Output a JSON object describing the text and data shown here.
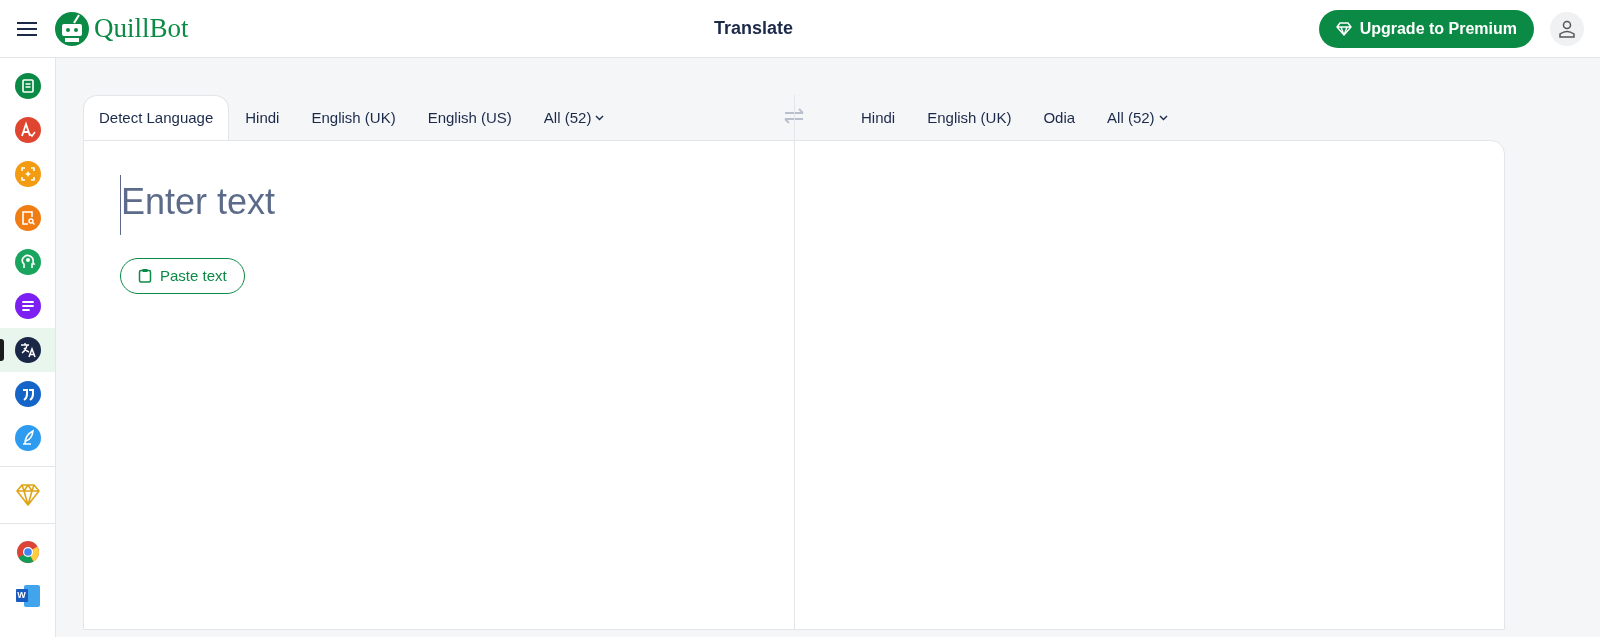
{
  "header": {
    "logo_text": "QuillBot",
    "title": "Translate",
    "upgrade_button": "Upgrade to Premium"
  },
  "sidebar": {
    "groups": [
      {
        "items": [
          {
            "kind": "paraphraser",
            "color": "#0b8a45",
            "selected": false
          },
          {
            "kind": "grammar",
            "color": "#e0452f",
            "selected": false
          },
          {
            "kind": "detector",
            "color": "#f39c12",
            "selected": false
          },
          {
            "kind": "plagiarism",
            "color": "#f07c14",
            "selected": false
          },
          {
            "kind": "humanizer",
            "color": "#1aa55e",
            "selected": false
          },
          {
            "kind": "summarizer",
            "color": "#7b1ff2",
            "selected": false
          },
          {
            "kind": "translator",
            "color": "#1a2746",
            "selected": true
          },
          {
            "kind": "citation",
            "color": "#1565c8",
            "selected": false
          },
          {
            "kind": "writer",
            "color": "#2d9bf0",
            "selected": false
          }
        ]
      },
      {
        "items": [
          {
            "kind": "premium",
            "color": "#e0a418",
            "selected": false
          }
        ]
      },
      {
        "items": [
          {
            "kind": "chrome",
            "color": "#4285f4",
            "selected": false
          },
          {
            "kind": "word",
            "color": "#185abd",
            "selected": false,
            "label": "W"
          }
        ]
      }
    ]
  },
  "source": {
    "tabs": [
      {
        "label": "Detect Language",
        "kind": "language",
        "selected": true
      },
      {
        "label": "Hindi",
        "kind": "language",
        "selected": false
      },
      {
        "label": "English (UK)",
        "kind": "language",
        "selected": false
      },
      {
        "label": "English (US)",
        "kind": "language",
        "selected": false
      },
      {
        "label": "All (52)",
        "kind": "dropdown",
        "selected": false
      }
    ],
    "input": {
      "placeholder": "Enter text"
    },
    "paste_button": "Paste text"
  },
  "target": {
    "tabs": [
      {
        "label": "Hindi",
        "kind": "language",
        "selected": false
      },
      {
        "label": "English (UK)",
        "kind": "language",
        "selected": false
      },
      {
        "label": "Odia",
        "kind": "language",
        "selected": false
      },
      {
        "label": "All (52)",
        "kind": "dropdown",
        "selected": false
      }
    ]
  }
}
